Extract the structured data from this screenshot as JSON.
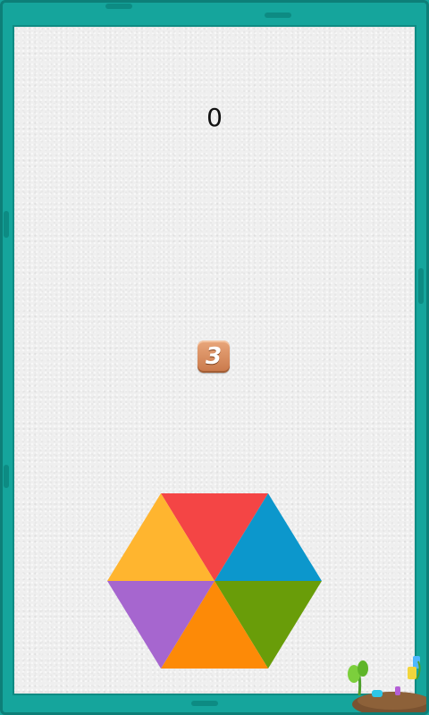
{
  "score": "0",
  "countdown": "3",
  "hexagon": {
    "segments": [
      {
        "name": "top",
        "color": "#f44545"
      },
      {
        "name": "upper-right",
        "color": "#0c97cc"
      },
      {
        "name": "lower-right",
        "color": "#699d09"
      },
      {
        "name": "bottom",
        "color": "#fd8a07"
      },
      {
        "name": "lower-left",
        "color": "#a666cf"
      },
      {
        "name": "upper-left",
        "color": "#ffb52f"
      }
    ]
  },
  "colors": {
    "frame": "#15a59c",
    "board": "#efefef",
    "countdown_tile": "#d98c5c"
  }
}
